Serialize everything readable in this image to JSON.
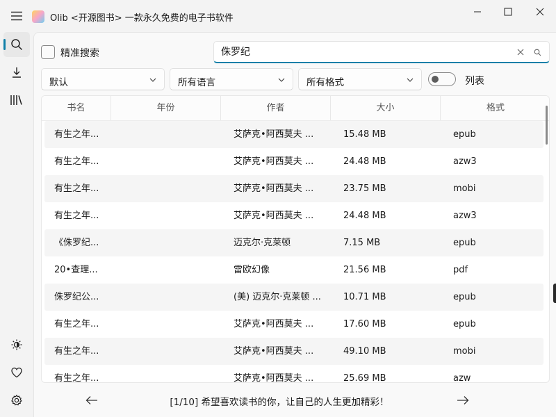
{
  "app": {
    "title": "Olib <开源图书> 一款永久免费的电子书软件"
  },
  "window_controls": {
    "minimize_icon": "minimize-icon",
    "maximize_icon": "maximize-icon",
    "close_icon": "close-icon"
  },
  "sidebar": {
    "items": [
      {
        "name": "search",
        "icon": "search-icon",
        "active": true
      },
      {
        "name": "downloads",
        "icon": "download-icon",
        "active": false
      },
      {
        "name": "library",
        "icon": "library-icon",
        "active": false
      }
    ],
    "bottom_items": [
      {
        "name": "theme",
        "icon": "brightness-icon"
      },
      {
        "name": "favorites",
        "icon": "heart-icon"
      },
      {
        "name": "settings",
        "icon": "gear-icon"
      }
    ]
  },
  "search": {
    "exact_label": "精准搜索",
    "exact_checked": false,
    "query": "侏罗纪"
  },
  "filters": {
    "sort": "默认",
    "language": "所有语言",
    "format": "所有格式",
    "list_toggle_label": "列表",
    "list_toggle_on": false
  },
  "table": {
    "headers": {
      "title": "书名",
      "year": "年份",
      "author": "作者",
      "size": "大小",
      "format": "格式"
    },
    "rows": [
      {
        "title": "有生之年...",
        "year": "",
        "author": "艾萨克•阿西莫夫 ...",
        "size": "15.48 MB",
        "format": "epub"
      },
      {
        "title": "有生之年...",
        "year": "",
        "author": "艾萨克•阿西莫夫 ...",
        "size": "24.48 MB",
        "format": "azw3"
      },
      {
        "title": "有生之年...",
        "year": "",
        "author": "艾萨克•阿西莫夫 ...",
        "size": "23.75 MB",
        "format": "mobi"
      },
      {
        "title": "有生之年...",
        "year": "",
        "author": "艾萨克•阿西莫夫 ...",
        "size": "24.48 MB",
        "format": "azw3"
      },
      {
        "title": "《侏罗纪...",
        "year": "",
        "author": "迈克尔·克莱顿",
        "size": "7.15 MB",
        "format": "epub"
      },
      {
        "title": "20•查理...",
        "year": "",
        "author": "雷欧幻像",
        "size": "21.56 MB",
        "format": "pdf"
      },
      {
        "title": "侏罗纪公...",
        "year": "",
        "author": "(美) 迈克尔·克莱顿 ...",
        "size": "10.71 MB",
        "format": "epub"
      },
      {
        "title": "有生之年...",
        "year": "",
        "author": "艾萨克•阿西莫夫 ...",
        "size": "17.60 MB",
        "format": "epub"
      },
      {
        "title": "有生之年...",
        "year": "",
        "author": "艾萨克•阿西莫夫 ...",
        "size": "49.10 MB",
        "format": "mobi"
      },
      {
        "title": "有生之年...",
        "year": "",
        "author": "艾萨克•阿西莫夫 ...",
        "size": "25.69 MB",
        "format": "azw"
      }
    ]
  },
  "footer": {
    "message": "[1/10] 希望喜欢读书的你，让自己的人生更加精彩！",
    "prev_icon": "arrow-left-icon",
    "next_icon": "arrow-right-icon"
  },
  "colors": {
    "accent": "#0f7fa8",
    "background": "#f3f3f3"
  }
}
